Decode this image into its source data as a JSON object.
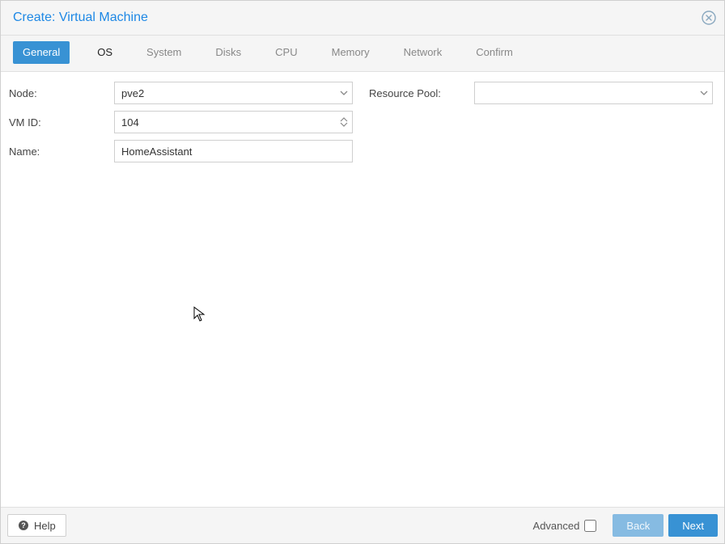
{
  "title": "Create: Virtual Machine",
  "tabs": {
    "general": "General",
    "os": "OS",
    "system": "System",
    "disks": "Disks",
    "cpu": "CPU",
    "memory": "Memory",
    "network": "Network",
    "confirm": "Confirm"
  },
  "form": {
    "node_label": "Node:",
    "node_value": "pve2",
    "vmid_label": "VM ID:",
    "vmid_value": "104",
    "name_label": "Name:",
    "name_value": "HomeAssistant",
    "pool_label": "Resource Pool:",
    "pool_value": ""
  },
  "footer": {
    "help": "Help",
    "advanced": "Advanced",
    "back": "Back",
    "next": "Next"
  }
}
